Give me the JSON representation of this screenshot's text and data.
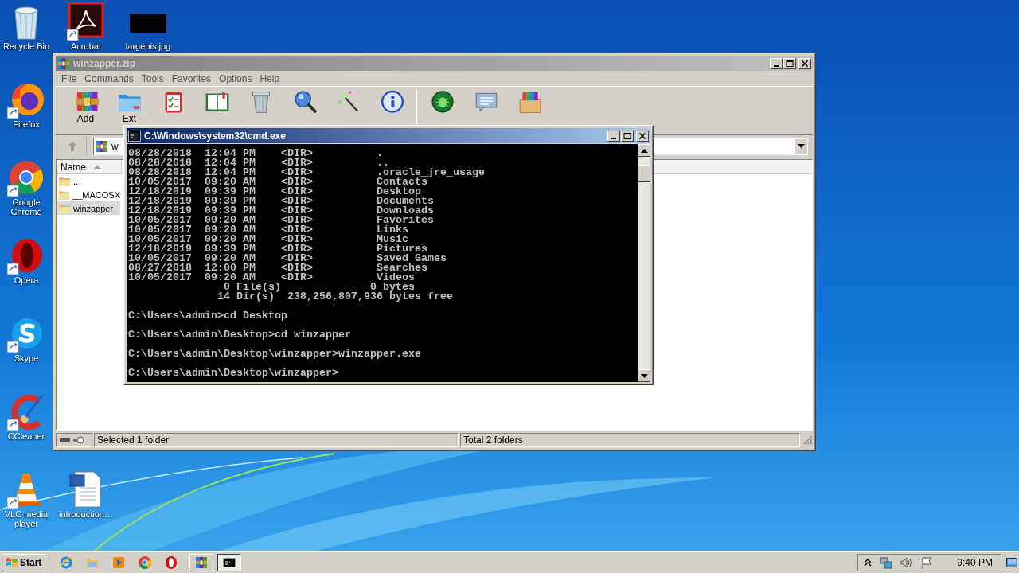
{
  "desktop": {
    "icons": [
      {
        "label": "Recycle Bin",
        "kind": "recycle",
        "shortcut": false
      },
      {
        "label": "Acrobat",
        "kind": "pdf",
        "shortcut": true
      },
      {
        "label": "largebis.jpg",
        "kind": "thumbnail",
        "shortcut": false
      },
      {
        "label": "Firefox",
        "kind": "firefox",
        "shortcut": true
      },
      {
        "label": "Google Chrome",
        "kind": "chrome",
        "shortcut": true
      },
      {
        "label": "Opera",
        "kind": "opera",
        "shortcut": true
      },
      {
        "label": "Skype",
        "kind": "skype",
        "shortcut": true
      },
      {
        "label": "CCleaner",
        "kind": "ccleaner",
        "shortcut": true
      },
      {
        "label": "VLC media player",
        "kind": "vlc",
        "shortcut": true
      },
      {
        "label": "introduction…",
        "kind": "document",
        "shortcut": false
      }
    ]
  },
  "archiver_window": {
    "title": "winzapper.zip",
    "active": false,
    "menu": [
      "File",
      "Commands",
      "Tools",
      "Favorites",
      "Options",
      "Help"
    ],
    "toolbar": [
      {
        "kind": "add",
        "label": "Add"
      },
      {
        "kind": "extract",
        "label": "Ext"
      },
      {
        "kind": "test"
      },
      {
        "kind": "view"
      },
      {
        "kind": "delete"
      },
      {
        "kind": "find"
      },
      {
        "kind": "wizard"
      },
      {
        "kind": "info"
      },
      {
        "kind": "separator"
      },
      {
        "kind": "virus"
      },
      {
        "kind": "comment"
      },
      {
        "kind": "sfx"
      }
    ],
    "address": "w",
    "column": {
      "label": "Name",
      "sorted": true
    },
    "files": [
      {
        "name": "..",
        "selected": false
      },
      {
        "name": "__MACOSX",
        "selected": false
      },
      {
        "name": "winzapper",
        "selected": true
      }
    ],
    "status_left": "Selected 1 folder",
    "status_right": "Total 2 folders"
  },
  "console_window": {
    "title": "C:\\Windows\\system32\\cmd.exe",
    "active": true,
    "listing": [
      "08/28/2018  12:04 PM    <DIR>          .",
      "08/28/2018  12:04 PM    <DIR>          ..",
      "08/28/2018  12:04 PM    <DIR>          .oracle_jre_usage",
      "10/05/2017  09:20 AM    <DIR>          Contacts",
      "12/18/2019  09:39 PM    <DIR>          Desktop",
      "12/18/2019  09:39 PM    <DIR>          Documents",
      "12/18/2019  09:39 PM    <DIR>          Downloads",
      "10/05/2017  09:20 AM    <DIR>          Favorites",
      "10/05/2017  09:20 AM    <DIR>          Links",
      "10/05/2017  09:20 AM    <DIR>          Music",
      "12/18/2019  09:39 PM    <DIR>          Pictures",
      "10/05/2017  09:20 AM    <DIR>          Saved Games",
      "08/27/2018  12:00 PM    <DIR>          Searches",
      "10/05/2017  09:20 AM    <DIR>          Videos",
      "               0 File(s)              0 bytes",
      "              14 Dir(s)  238,256,807,936 bytes free"
    ],
    "commands": [
      {
        "prompt": "C:\\Users\\admin>",
        "input": "cd Desktop"
      },
      {
        "prompt": "C:\\Users\\admin\\Desktop>",
        "input": "cd winzapper"
      },
      {
        "prompt": "C:\\Users\\admin\\Desktop\\winzapper>",
        "input": "winzapper.exe"
      },
      {
        "prompt": "C:\\Users\\admin\\Desktop\\winzapper>"
      }
    ]
  },
  "taskbar": {
    "start": "Start",
    "quick_launch": [
      {
        "kind": "ie"
      },
      {
        "kind": "explorer"
      },
      {
        "kind": "media"
      },
      {
        "kind": "chrome"
      },
      {
        "kind": "opera"
      }
    ],
    "buttons": [
      {
        "kind": "archiver",
        "selected": false
      },
      {
        "kind": "console",
        "selected": true
      }
    ],
    "tray": [
      {
        "kind": "chevron"
      },
      {
        "kind": "network"
      },
      {
        "kind": "volume"
      },
      {
        "kind": "flag"
      }
    ],
    "clock": "9:40 PM"
  }
}
